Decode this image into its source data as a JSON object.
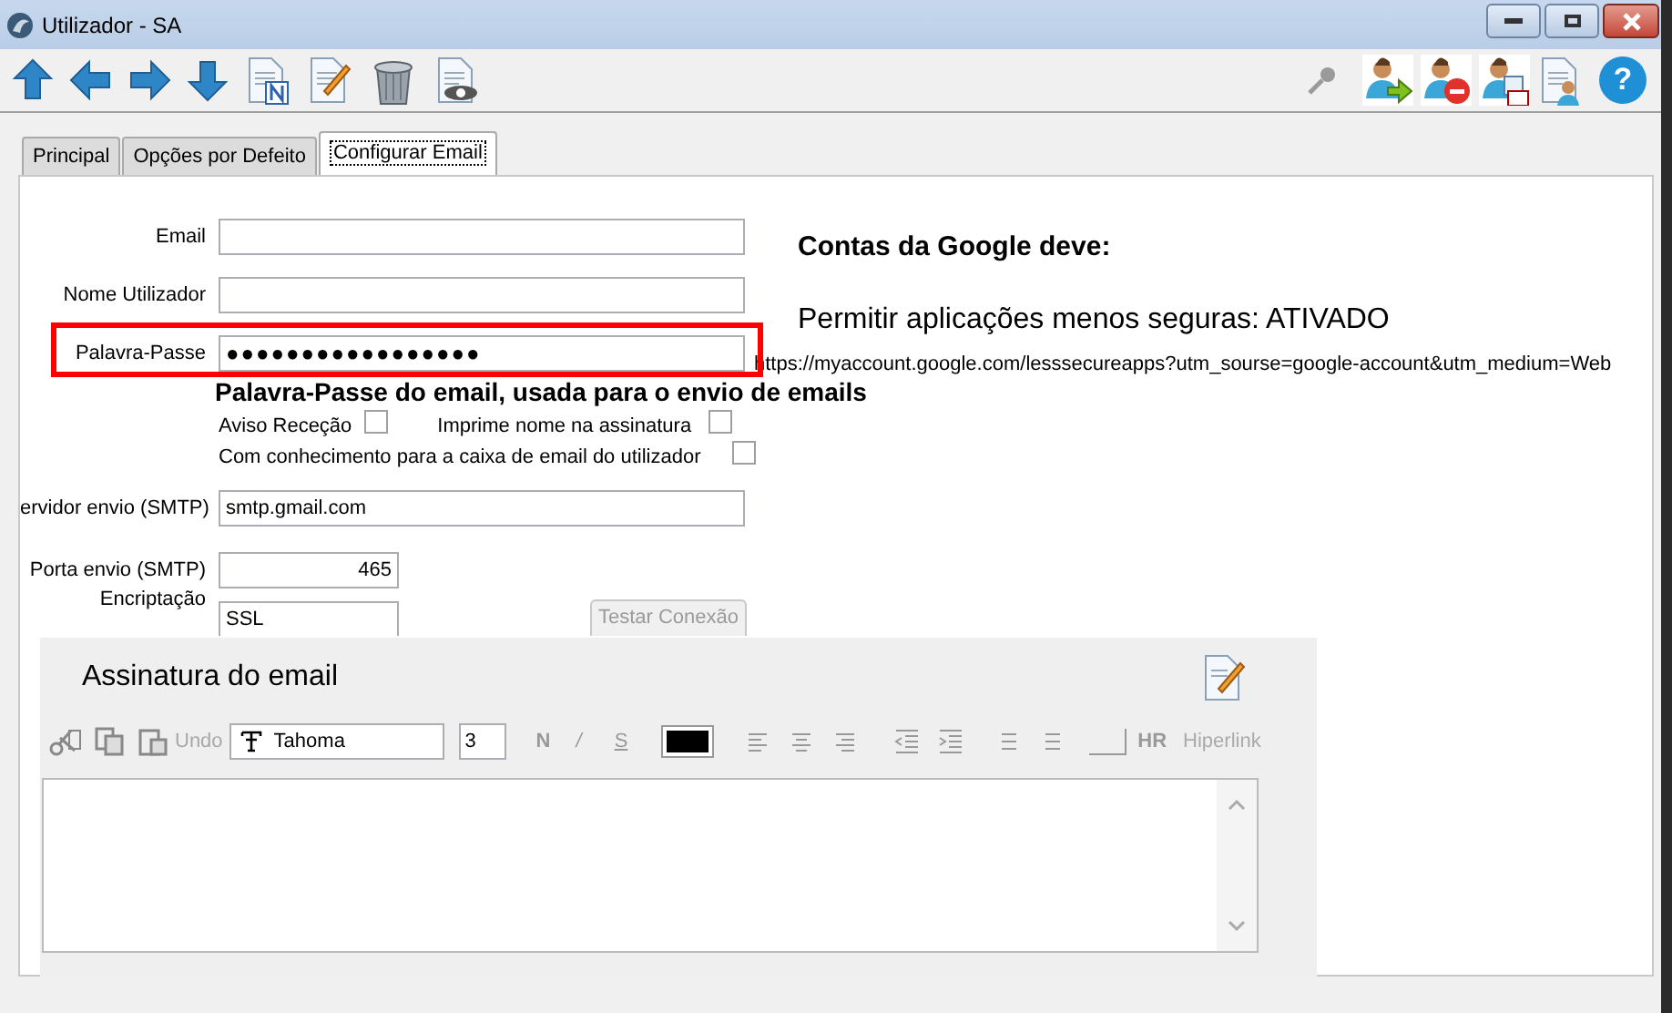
{
  "window": {
    "title": "Utilizador - SA"
  },
  "tabs": [
    {
      "label": "Principal",
      "selected": false
    },
    {
      "label": "Opções por Defeito",
      "selected": false
    },
    {
      "label": "Configurar Email",
      "selected": true
    }
  ],
  "help_button": {
    "label": "?"
  },
  "fields": [
    {
      "label": "Email",
      "kind": "text"
    },
    {
      "label": "Nome Utilizador",
      "kind": "text"
    },
    {
      "label": "Palavra-Passe",
      "value": "●●●●●●●●●●●●●●●●●",
      "kind": "password",
      "hint": "Palavra-Passe do email,  usada para o  envio de emails"
    }
  ],
  "checkboxes": [
    {
      "label": "Aviso Receção",
      "checked": false
    },
    {
      "label": "Imprime nome na assinatura",
      "checked": false
    },
    {
      "label": "Com conhecimento para a caixa de email do utilizador",
      "checked": false
    }
  ],
  "smtp_server": {
    "label": "ervidor envio (SMTP)",
    "value": "smtp.gmail.com"
  },
  "smtp_port": {
    "label": "Porta envio (SMTP)",
    "value": "465"
  },
  "encryption": {
    "label": "Encriptação",
    "value": "SSL"
  },
  "test_button": {
    "label": "Testar Conexão",
    "disabled": true
  },
  "google_note": {
    "heading": "Contas da Google deve:",
    "text": "Permitir aplicações menos seguras: ATIVADO",
    "url": "https://myaccount.google.com/lesssecureapps?utm_sourse=google-account&utm_medium=Web"
  },
  "signature": {
    "title": "Assinatura do email",
    "undo": {
      "label": "Undo",
      "disabled": true
    },
    "font": "Tahoma",
    "size": "3",
    "bold": "N",
    "italic": "/",
    "strike": "S",
    "hr": "HR",
    "hyperlink": "Hiperlink"
  }
}
